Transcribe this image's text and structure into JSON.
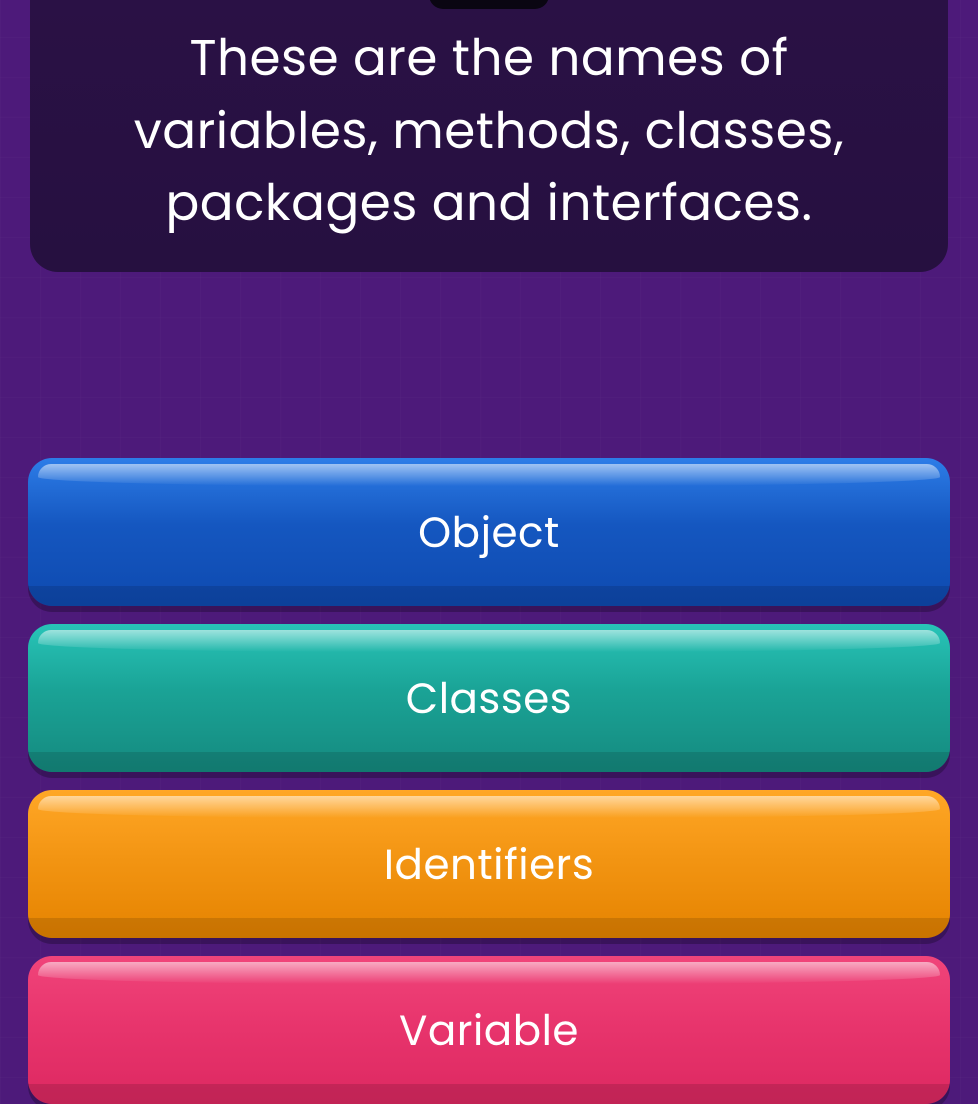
{
  "question": {
    "text": "These are the names of variables, methods, classes, packages and interfaces."
  },
  "answers": [
    {
      "id": "object",
      "label": "Object",
      "color": "blue"
    },
    {
      "id": "classes",
      "label": "Classes",
      "color": "teal"
    },
    {
      "id": "identifiers",
      "label": "Identifiers",
      "color": "orange"
    },
    {
      "id": "variable",
      "label": "Variable",
      "color": "pink"
    }
  ]
}
